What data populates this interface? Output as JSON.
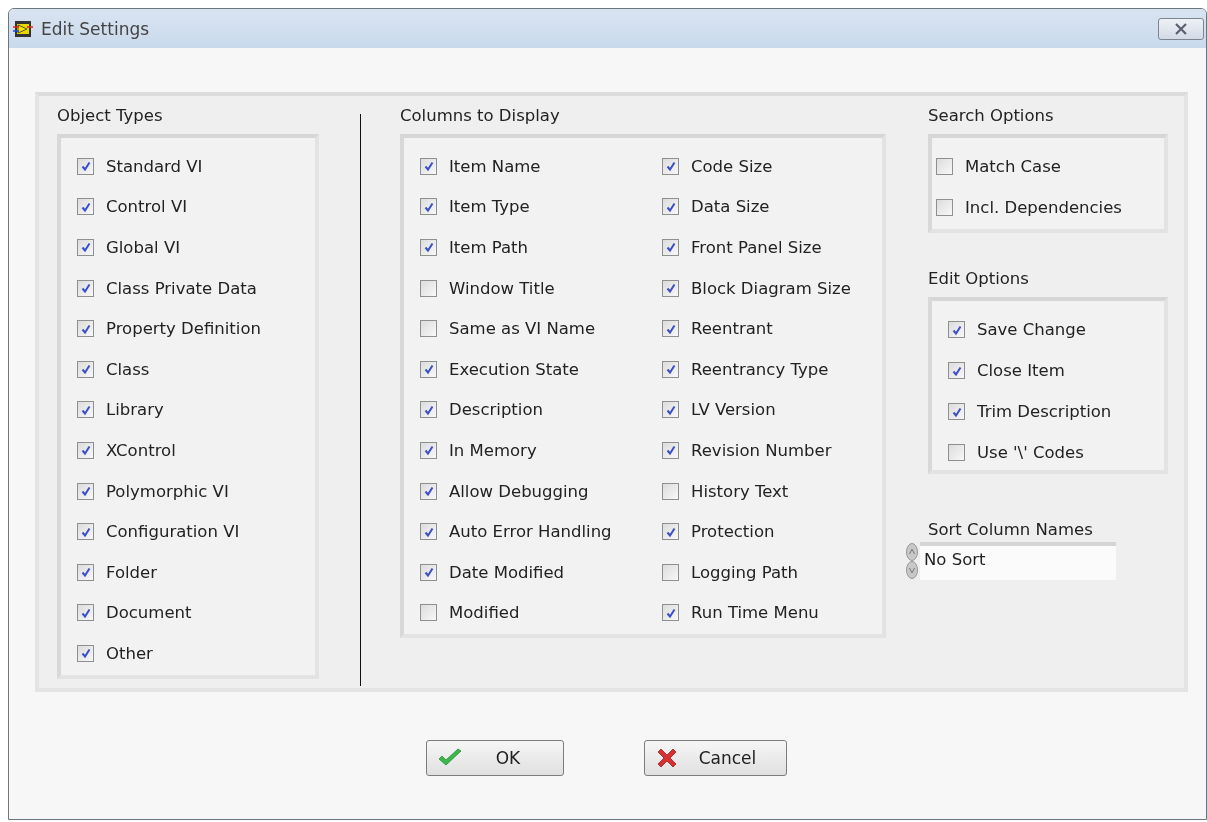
{
  "window": {
    "title": "Edit Settings"
  },
  "object_types": {
    "label": "Object Types",
    "items": [
      {
        "label": "Standard VI",
        "checked": true
      },
      {
        "label": "Control VI",
        "checked": true
      },
      {
        "label": "Global VI",
        "checked": true
      },
      {
        "label": "Class Private Data",
        "checked": true
      },
      {
        "label": "Property Definition",
        "checked": true
      },
      {
        "label": "Class",
        "checked": true
      },
      {
        "label": "Library",
        "checked": true
      },
      {
        "label": "XControl",
        "checked": true
      },
      {
        "label": "Polymorphic VI",
        "checked": true
      },
      {
        "label": "Configuration VI",
        "checked": true
      },
      {
        "label": "Folder",
        "checked": true
      },
      {
        "label": "Document",
        "checked": true
      },
      {
        "label": "Other",
        "checked": true
      }
    ]
  },
  "columns_to_display": {
    "label": "Columns to Display",
    "items": [
      {
        "label": "Item Name",
        "checked": true
      },
      {
        "label": "Item Type",
        "checked": true
      },
      {
        "label": "Item Path",
        "checked": true
      },
      {
        "label": "Window Title",
        "checked": false
      },
      {
        "label": "Same as VI Name",
        "checked": false
      },
      {
        "label": "Execution State",
        "checked": true
      },
      {
        "label": "Description",
        "checked": true
      },
      {
        "label": "In Memory",
        "checked": true
      },
      {
        "label": "Allow Debugging",
        "checked": true
      },
      {
        "label": "Auto Error Handling",
        "checked": true
      },
      {
        "label": "Date Modified",
        "checked": true
      },
      {
        "label": "Modified",
        "checked": false
      },
      {
        "label": "Code Size",
        "checked": true
      },
      {
        "label": "Data Size",
        "checked": true
      },
      {
        "label": "Front Panel Size",
        "checked": true
      },
      {
        "label": "Block Diagram Size",
        "checked": true
      },
      {
        "label": "Reentrant",
        "checked": true
      },
      {
        "label": "Reentrancy Type",
        "checked": true
      },
      {
        "label": "LV Version",
        "checked": true
      },
      {
        "label": "Revision Number",
        "checked": true
      },
      {
        "label": "History Text",
        "checked": false
      },
      {
        "label": "Protection",
        "checked": true
      },
      {
        "label": "Logging Path",
        "checked": false
      },
      {
        "label": "Run Time Menu",
        "checked": true
      }
    ]
  },
  "search_options": {
    "label": "Search Options",
    "items": [
      {
        "label": "Match Case",
        "checked": false
      },
      {
        "label": "Incl. Dependencies",
        "checked": false
      }
    ]
  },
  "edit_options": {
    "label": "Edit Options",
    "items": [
      {
        "label": "Save Change",
        "checked": true
      },
      {
        "label": "Close Item",
        "checked": true
      },
      {
        "label": "Trim Description",
        "checked": true
      },
      {
        "label": "Use '\\' Codes",
        "checked": false
      }
    ]
  },
  "sort_column_names": {
    "label": "Sort Column Names",
    "value": "No Sort"
  },
  "buttons": [
    {
      "label": "OK",
      "kind": "ok"
    },
    {
      "label": "Cancel",
      "kind": "cancel"
    }
  ]
}
